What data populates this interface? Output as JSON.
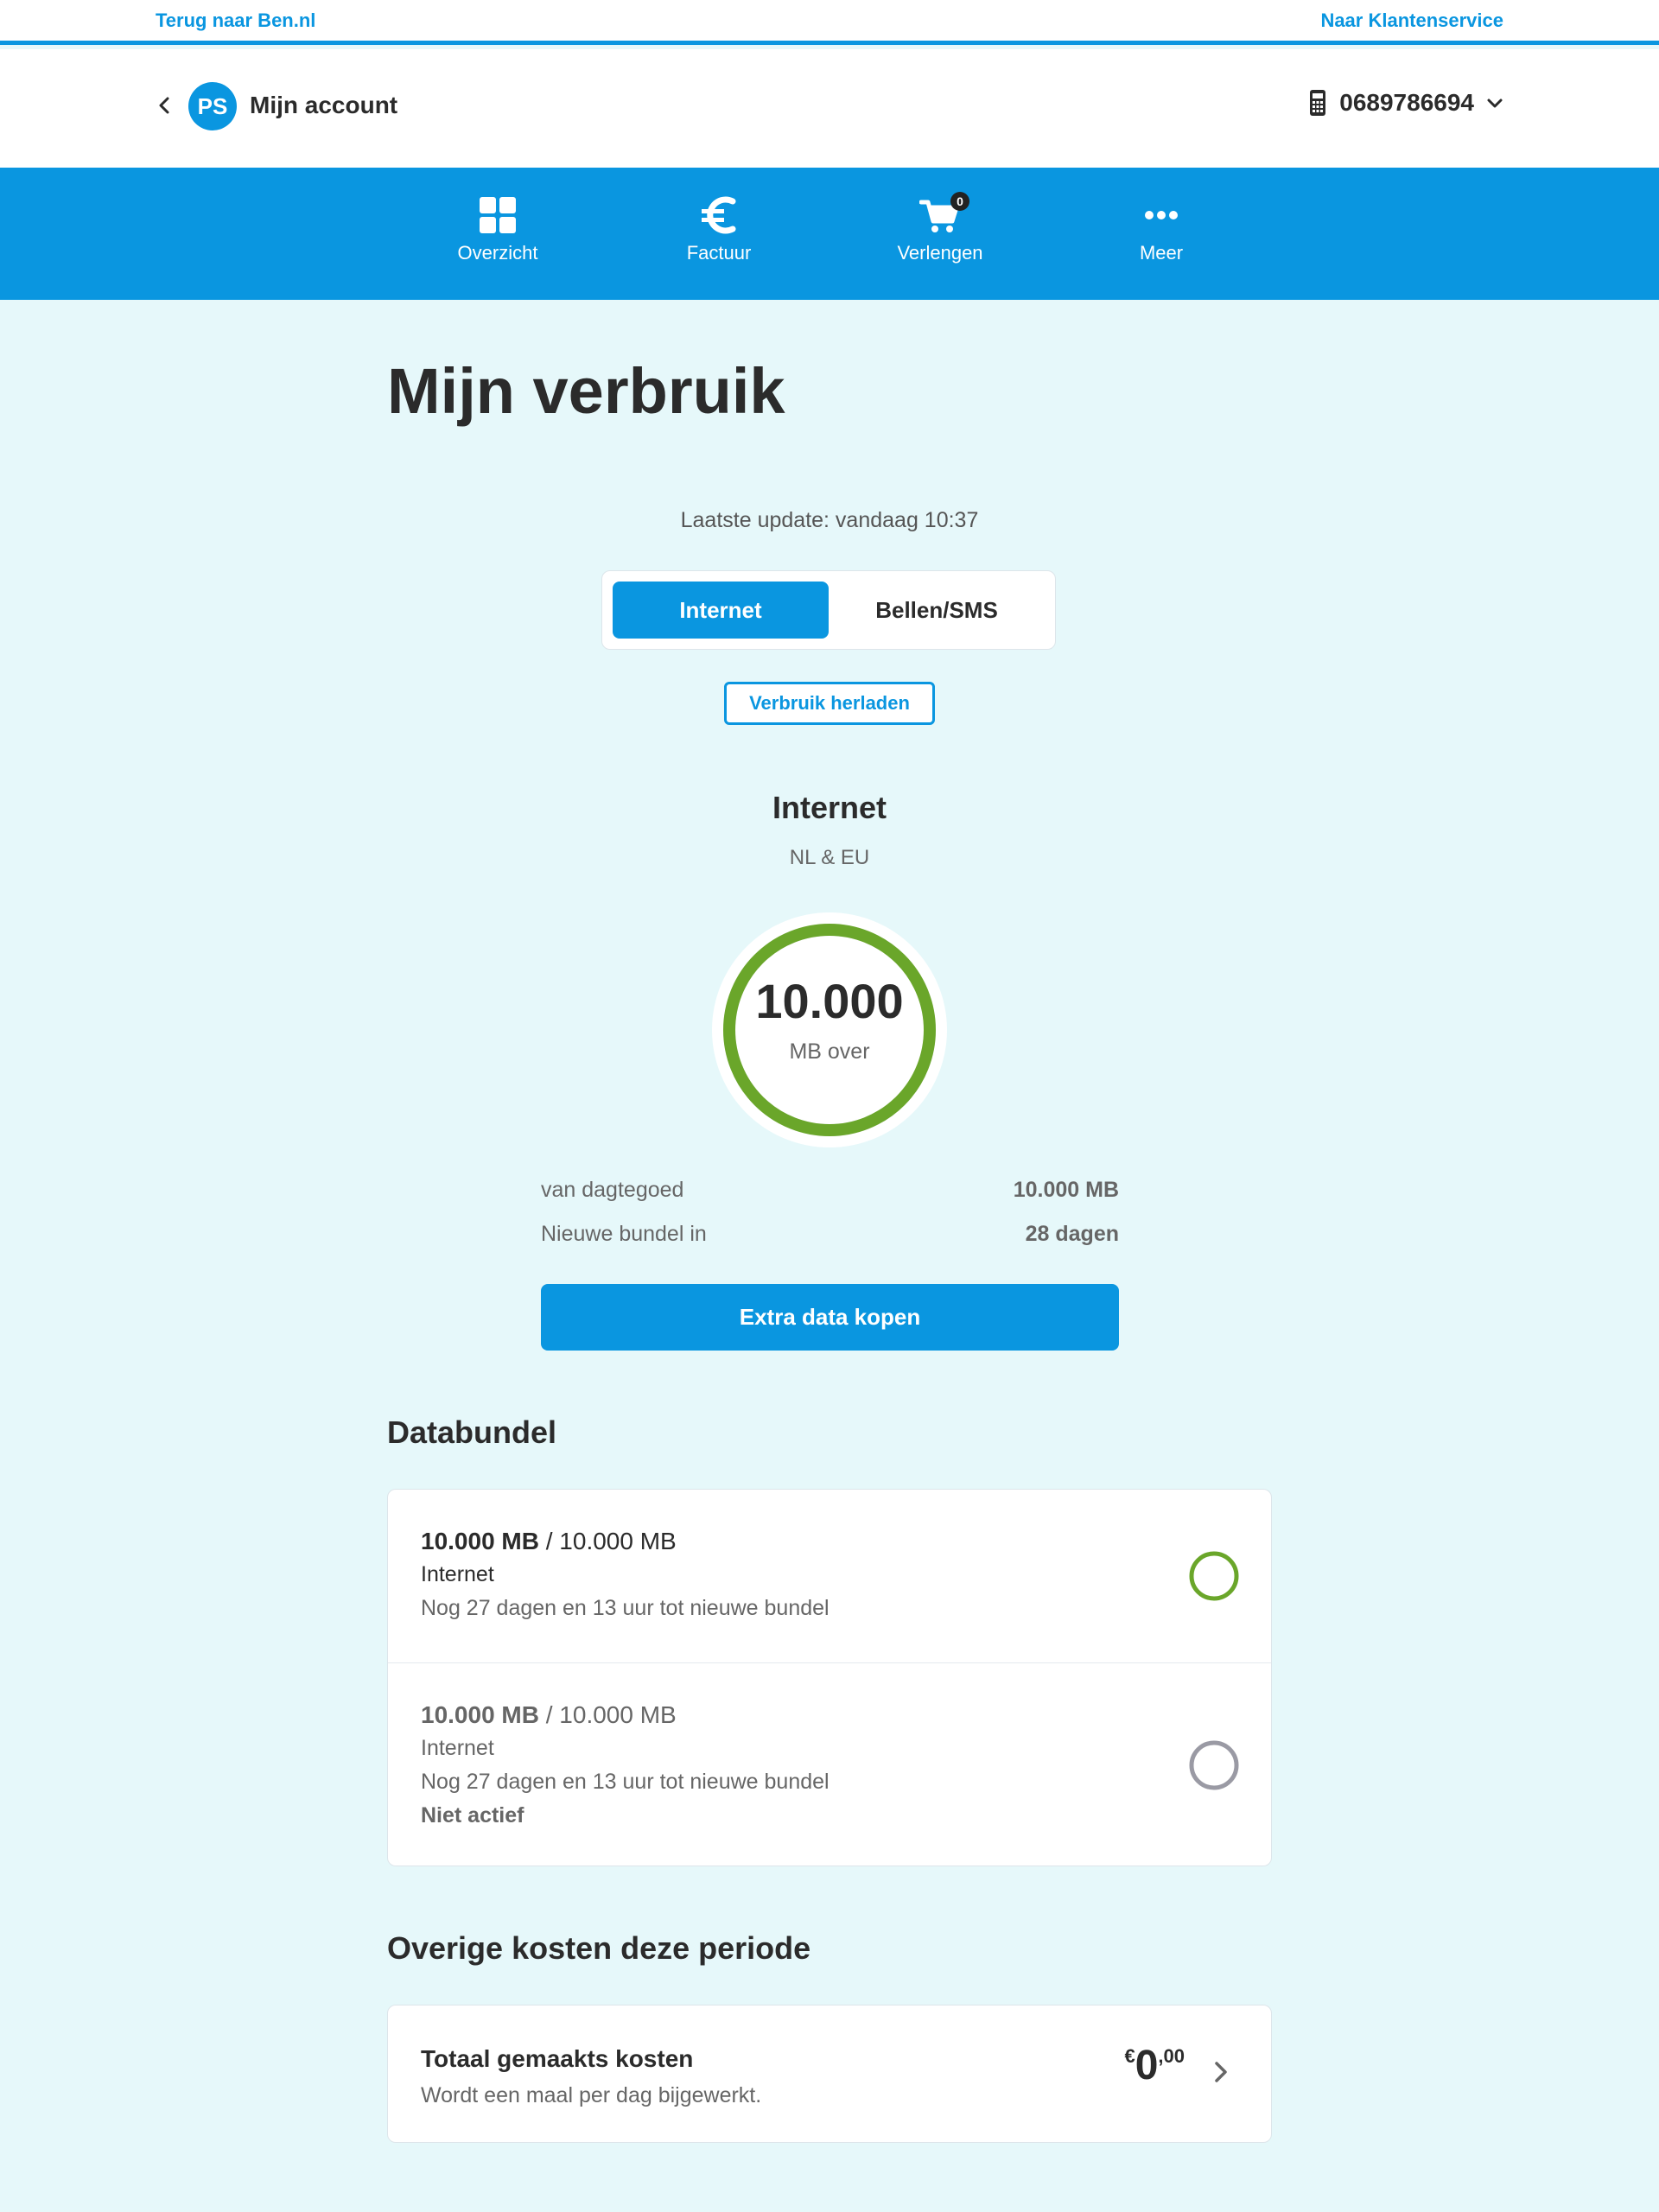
{
  "topbar": {
    "back_link": "Terug naar Ben.nl",
    "service_link": "Naar Klantenservice"
  },
  "account": {
    "initials": "PS",
    "title": "Mijn account",
    "phone_number": "0689786694"
  },
  "nav": {
    "items": [
      {
        "label": "Overzicht",
        "icon": "grid-icon"
      },
      {
        "label": "Factuur",
        "icon": "euro-icon"
      },
      {
        "label": "Verlengen",
        "icon": "cart-icon",
        "badge": "0"
      },
      {
        "label": "Meer",
        "icon": "more-dots-icon"
      }
    ]
  },
  "page": {
    "title": "Mijn verbruik",
    "last_update": "Laatste update: vandaag 10:37"
  },
  "tabs": [
    {
      "label": "Internet",
      "active": true
    },
    {
      "label": "Bellen/SMS",
      "active": false
    }
  ],
  "reload_button": "Verbruik herladen",
  "usage": {
    "heading": "Internet",
    "region": "NL & EU",
    "remaining_value": "10.000",
    "remaining_unit": "MB over",
    "remaining_fraction": 1.0,
    "stats": [
      {
        "label": "van dagtegoed",
        "value": "10.000 MB"
      },
      {
        "label": "Nieuwe bundel in",
        "value": "28 dagen"
      }
    ],
    "cta": "Extra data kopen"
  },
  "databundel": {
    "heading": "Databundel",
    "bundles": [
      {
        "amount": "10.000 MB",
        "total": " / 10.000 MB",
        "type": "Internet",
        "remaining": "Nog 27 dagen en 13 uur tot nieuwe bundel",
        "status": "",
        "ring_color": "#6aa62a"
      },
      {
        "amount": "10.000 MB",
        "total": " / 10.000 MB",
        "type": "Internet",
        "remaining": "Nog 27 dagen en 13 uur tot nieuwe bundel",
        "status": "Niet actief",
        "ring_color": "#9a9aa4"
      }
    ]
  },
  "costs": {
    "heading": "Overige kosten deze periode",
    "title": "Totaal gemaakts kosten",
    "subtitle": "Wordt een maal per dag bijgewerkt.",
    "currency": "€",
    "amount_main": "0",
    "amount_sep": ",",
    "amount_cents": "00"
  },
  "colors": {
    "brand": "#0a96e0",
    "gauge_green": "#6aa62a",
    "background": "#e6f8fa"
  }
}
